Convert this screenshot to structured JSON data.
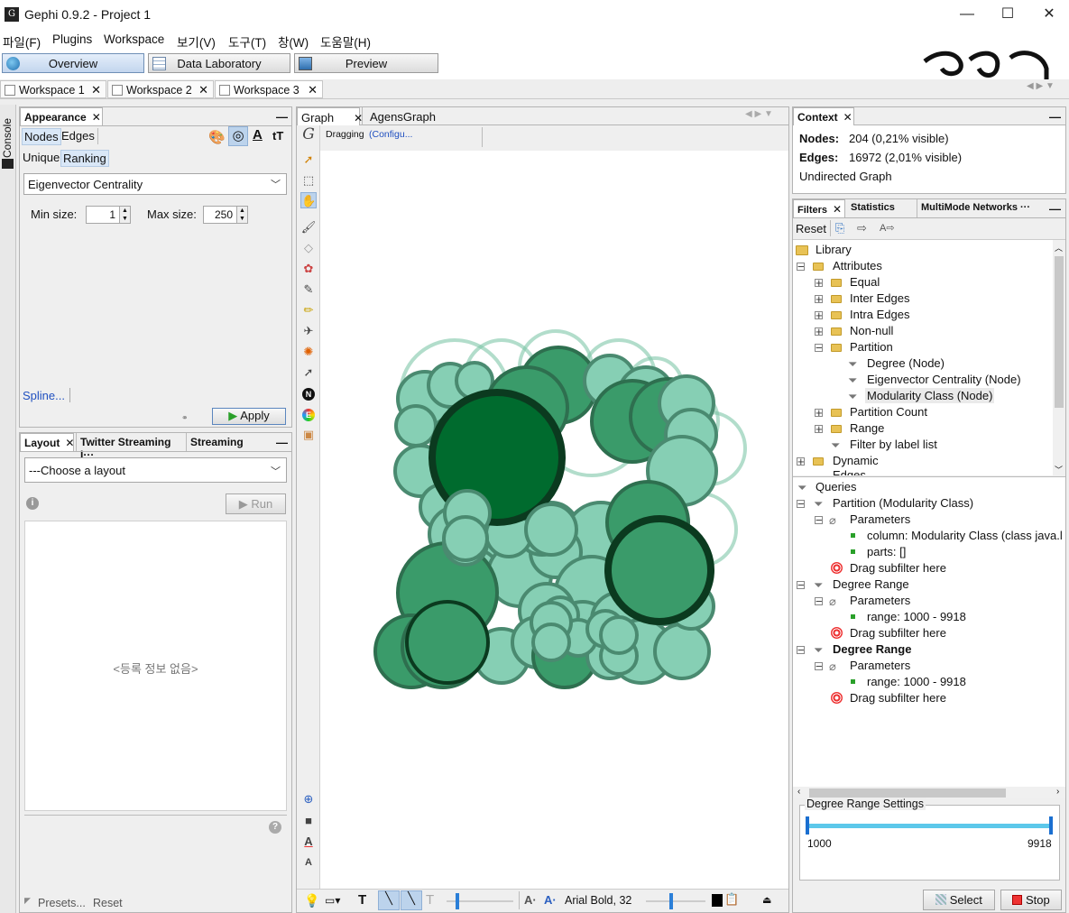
{
  "window": {
    "title": "Gephi 0.9.2 - Project 1",
    "min": "—",
    "max": "☐",
    "close": "✕"
  },
  "menu": [
    "파일(F)",
    "Plugins",
    "Workspace",
    "보기(V)",
    "도구(T)",
    "창(W)",
    "도움말(H)"
  ],
  "modes": {
    "overview": "Overview",
    "data_lab": "Data Laboratory",
    "preview": "Preview"
  },
  "workspaces": [
    "Workspace 1",
    "Workspace 2",
    "Workspace 3"
  ],
  "appearance": {
    "tab": "Appearance",
    "nodes": "Nodes",
    "edges": "Edges",
    "unique": "Unique",
    "ranking": "Ranking",
    "attribute": "Eigenvector Centrality",
    "min_label": "Min size:",
    "min_value": "1",
    "max_label": "Max size:",
    "max_value": "250",
    "spline": "Spline...",
    "apply": "Apply"
  },
  "layout": {
    "tabs": [
      "Layout",
      "Twitter Streaming I···",
      "Streaming"
    ],
    "choose": "---Choose a layout",
    "run": "Run",
    "empty": "<등록 정보 없음>",
    "presets": "Presets...",
    "reset": "Reset"
  },
  "console_label": "Console",
  "graph": {
    "tabs": [
      "Graph",
      "AgensGraph Import"
    ],
    "mode": "Dragging",
    "configure": "(Configu...",
    "font": "Arial Bold, 32"
  },
  "context": {
    "tab": "Context",
    "nodes_label": "Nodes:",
    "nodes_value": "204 (0,21% visible)",
    "edges_label": "Edges:",
    "edges_value": "16972 (2,01% visible)",
    "graph_type": "Undirected Graph"
  },
  "filters": {
    "tabs": [
      "Filters",
      "Statistics",
      "MultiMode Networks ···"
    ],
    "reset": "Reset",
    "library": {
      "root": "Library",
      "attributes": "Attributes",
      "items": [
        "Equal",
        "Inter Edges",
        "Intra Edges",
        "Non-null",
        "Partition"
      ],
      "partition_children": [
        "Degree (Node)",
        "Eigenvector Centrality (Node)",
        "Modularity Class (Node)"
      ],
      "more": [
        "Partition Count",
        "Range",
        "Filter by label list"
      ],
      "dynamic": "Dynamic",
      "edges_cut": "Edges"
    },
    "queries": {
      "root": "Queries",
      "q1": "Partition (Modularity Class)",
      "parameters": "Parameters",
      "column": "column: Modularity Class (class java.l",
      "parts": "parts: []",
      "drag": "Drag subfilter here",
      "q2": "Degree Range",
      "range": "range: 1000 - 9918",
      "q3": "Degree Range"
    },
    "settings": {
      "title": "Degree Range Settings",
      "min": "1000",
      "max": "9918"
    },
    "select": "Select",
    "stop": "Stop"
  },
  "colors": {
    "accent_blue": "#5cc8ea",
    "node_dark": "#006b2e",
    "node_mid": "#3a9b6a",
    "node_light": "#86cfb4"
  }
}
